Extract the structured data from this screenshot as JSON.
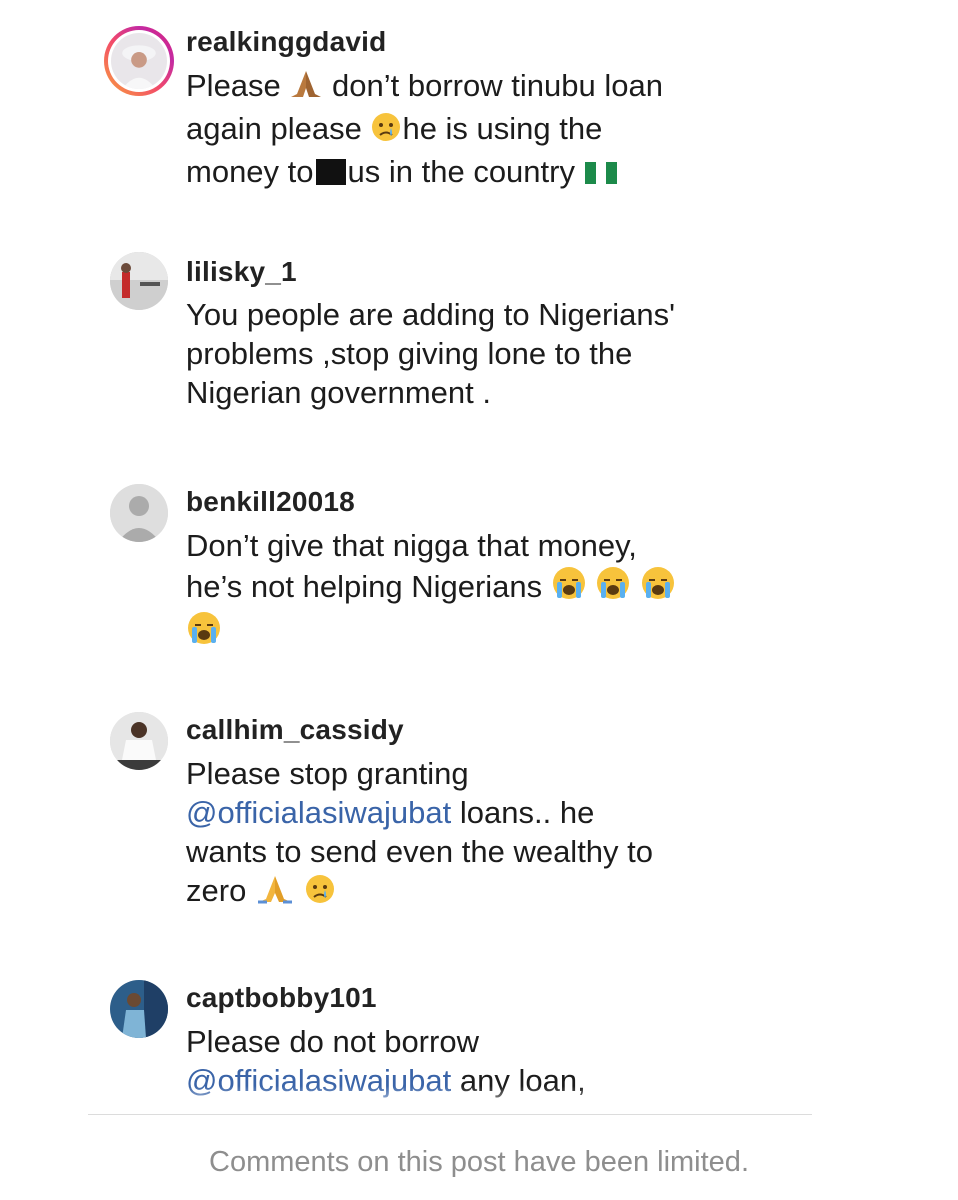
{
  "comments": [
    {
      "username": "realkinggdavid",
      "lines": [
        "Please",
        "don’t borrow tinubu loan",
        "again please",
        "he is using the",
        "money to",
        "us in the country"
      ]
    },
    {
      "username": "lilisky_1",
      "lines": [
        "You people are adding to Nigerians'",
        "problems ,stop giving lone to the",
        "Nigerian government ."
      ]
    },
    {
      "username": "benkill20018",
      "lines": [
        "Don’t give that nigga that money,",
        "he’s not helping Nigerians"
      ]
    },
    {
      "username": "callhim_cassidy",
      "lines": [
        "Please stop granting",
        "@officialasiwajubat",
        "loans.. he",
        "wants to send even the wealthy to",
        "zero"
      ]
    },
    {
      "username": "captbobby101",
      "lines": [
        "Please do not borrow",
        "@officialasiwajubat",
        "any loan,"
      ]
    }
  ],
  "footer": {
    "notice": "Comments on this post have been limited."
  },
  "icons": {
    "emoji": [
      "folded-hands-icon",
      "crying-face-icon",
      "nigeria-flag-icon",
      "loudly-crying-face-icon"
    ]
  }
}
